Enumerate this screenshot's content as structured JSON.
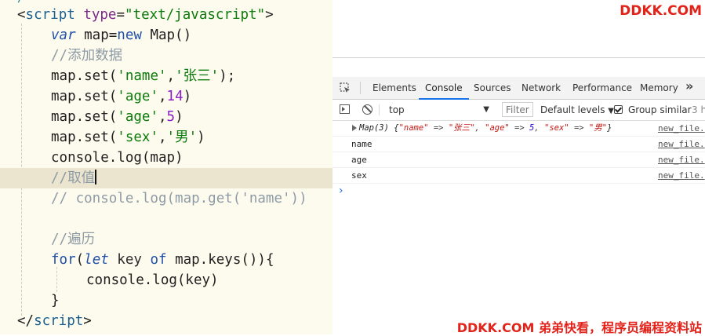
{
  "editor": {
    "lines": [
      {
        "n": "script-open",
        "tokens": [
          {
            "t": "<",
            "c": "punc"
          },
          {
            "t": "script",
            "c": "tag"
          },
          {
            "t": " ",
            "c": "var"
          },
          {
            "t": "type",
            "c": "attr"
          },
          {
            "t": "=",
            "c": "punc"
          },
          {
            "t": "\"text/javascript\"",
            "c": "str"
          },
          {
            "t": ">",
            "c": "punc"
          }
        ]
      },
      {
        "n": "var-declaration",
        "tokens": [
          {
            "t": "var",
            "c": "kw"
          },
          {
            "t": " map=",
            "c": "var"
          },
          {
            "t": "new",
            "c": "new"
          },
          {
            "t": " Map()",
            "c": "var"
          }
        ]
      },
      {
        "n": "comment-add-data",
        "tokens": [
          {
            "t": "//添加数据",
            "c": "com"
          }
        ]
      },
      {
        "n": "set-name",
        "tokens": [
          {
            "t": "map.set(",
            "c": "var"
          },
          {
            "t": "'name'",
            "c": "str"
          },
          {
            "t": ",",
            "c": "var"
          },
          {
            "t": "'张三'",
            "c": "str"
          },
          {
            "t": ");",
            "c": "var"
          }
        ]
      },
      {
        "n": "set-age-14",
        "tokens": [
          {
            "t": "map.set(",
            "c": "var"
          },
          {
            "t": "'age'",
            "c": "str"
          },
          {
            "t": ",",
            "c": "var"
          },
          {
            "t": "14",
            "c": "num"
          },
          {
            "t": ")",
            "c": "var"
          }
        ]
      },
      {
        "n": "set-age-5",
        "tokens": [
          {
            "t": "map.set(",
            "c": "var"
          },
          {
            "t": "'age'",
            "c": "str"
          },
          {
            "t": ",",
            "c": "var"
          },
          {
            "t": "5",
            "c": "num"
          },
          {
            "t": ")",
            "c": "var"
          }
        ]
      },
      {
        "n": "set-sex",
        "tokens": [
          {
            "t": "map.set(",
            "c": "var"
          },
          {
            "t": "'sex'",
            "c": "str"
          },
          {
            "t": ",",
            "c": "var"
          },
          {
            "t": "'男'",
            "c": "str"
          },
          {
            "t": ")",
            "c": "var"
          }
        ]
      },
      {
        "n": "log-map",
        "tokens": [
          {
            "t": "console.log(map)",
            "c": "var"
          }
        ]
      },
      {
        "n": "comment-get-value",
        "tokens": [
          {
            "t": "//取值",
            "c": "com"
          }
        ],
        "current": true
      },
      {
        "n": "comment-get-name",
        "tokens": [
          {
            "t": "// console.log(map.get('name'))",
            "c": "com"
          }
        ]
      },
      {
        "n": "blank",
        "tokens": []
      },
      {
        "n": "comment-traverse",
        "tokens": [
          {
            "t": "//遍历",
            "c": "com"
          }
        ]
      },
      {
        "n": "for-of-keys",
        "tokens": [
          {
            "t": "for",
            "c": "for"
          },
          {
            "t": "(",
            "c": "var"
          },
          {
            "t": "let",
            "c": "kw"
          },
          {
            "t": " key ",
            "c": "key"
          },
          {
            "t": "of",
            "c": "for"
          },
          {
            "t": " map.keys()){",
            "c": "var"
          }
        ]
      },
      {
        "n": "log-key",
        "tokens": [
          {
            "t": "console.log(key)",
            "c": "var"
          }
        ]
      },
      {
        "n": "close-brace",
        "tokens": [
          {
            "t": "}",
            "c": "var"
          }
        ]
      },
      {
        "n": "script-close",
        "tokens": [
          {
            "t": "</",
            "c": "punc"
          },
          {
            "t": "script",
            "c": "tag"
          },
          {
            "t": ">",
            "c": "punc"
          }
        ]
      }
    ]
  },
  "watermark": {
    "top": "DDKK.COM",
    "bottom": "DDKK.COM 弟弟快看，程序员编程资料站"
  },
  "devtools": {
    "tabs": [
      "Elements",
      "Console",
      "Sources",
      "Network",
      "Performance",
      "Memory"
    ],
    "active_tab": "Console",
    "more": "»",
    "toolbar": {
      "context": "top",
      "filter_placeholder": "Filter",
      "levels": "Default levels",
      "group_similar": "Group similar",
      "group_similar_checked": true,
      "timestamp": "3 h"
    },
    "console": {
      "map_log": {
        "prefix": "Map(3) {",
        "entries": [
          {
            "key": "\"name\"",
            "arrow": " => ",
            "value": "\"张三\"",
            "type": "str"
          },
          {
            "key": "\"age\"",
            "arrow": " => ",
            "value": "5",
            "type": "num"
          },
          {
            "key": "\"sex\"",
            "arrow": " => ",
            "value": "\"男\"",
            "type": "str"
          }
        ],
        "suffix": "}",
        "source": "new_file."
      },
      "logs": [
        {
          "text": "name",
          "source": "new_file."
        },
        {
          "text": "age",
          "source": "new_file."
        },
        {
          "text": "sex",
          "source": "new_file."
        }
      ],
      "prompt": "›"
    }
  }
}
